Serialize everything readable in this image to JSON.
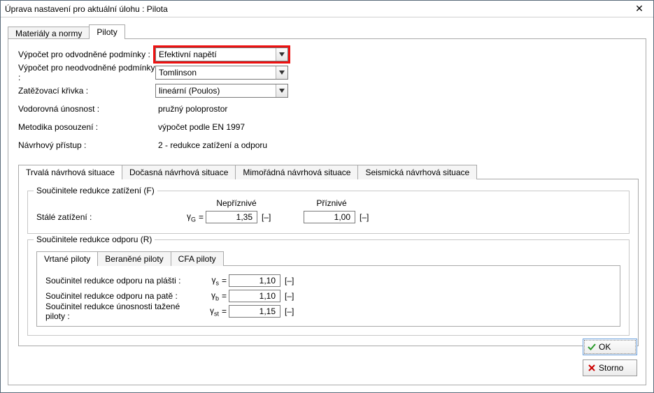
{
  "window": {
    "title": "Úprava nastavení pro aktuální úlohu : Pilota",
    "close_glyph": "✕"
  },
  "top_tabs": {
    "materials": "Materiály a normy",
    "piles": "Piloty"
  },
  "settings": {
    "drained_label": "Výpočet pro odvodněné podmínky :",
    "drained_value": "Efektivní napětí",
    "undrained_label": "Výpočet pro neodvodněné podmínky :",
    "undrained_value": "Tomlinson",
    "loadcurve_label": "Zatěžovací křivka :",
    "loadcurve_value": "lineární (Poulos)",
    "horiz_label": "Vodorovná únosnost :",
    "horiz_value": "pružný poloprostor",
    "method_label": "Metodika posouzení :",
    "method_value": "výpočet podle EN 1997",
    "approach_label": "Návrhový přístup :",
    "approach_value": "2 - redukce zatížení a odporu"
  },
  "ds_tabs": {
    "t1": "Trvalá návrhová situace",
    "t2": "Dočasná návrhová situace",
    "t3": "Mimořádná návrhová situace",
    "t4": "Seismická návrhová situace"
  },
  "groupF": {
    "legend": "Součinitele redukce zatížení (F)",
    "col_adverse": "Nepříznivé",
    "col_favorable": "Příznivé",
    "perm_label": "Stálé zatížení :",
    "sym_gammaG": "γG",
    "val_adverse": "1,35",
    "val_favorable": "1,00",
    "unit": "[–]"
  },
  "groupR": {
    "legend": "Součinitele redukce odporu (R)",
    "ptabs": {
      "t1": "Vrtané piloty",
      "t2": "Beraněné piloty",
      "t3": "CFA piloty"
    },
    "r1_label": "Součinitel redukce odporu na plášti :",
    "r1_sym": "γs",
    "r1_val": "1,10",
    "r2_label": "Součinitel redukce odporu na patě :",
    "r2_sym": "γb",
    "r2_val": "1,10",
    "r3_label": "Součinitel redukce únosnosti tažené piloty :",
    "r3_sym": "γst",
    "r3_val": "1,15",
    "unit": "[–]"
  },
  "footer": {
    "ok": "OK",
    "cancel": "Storno"
  }
}
